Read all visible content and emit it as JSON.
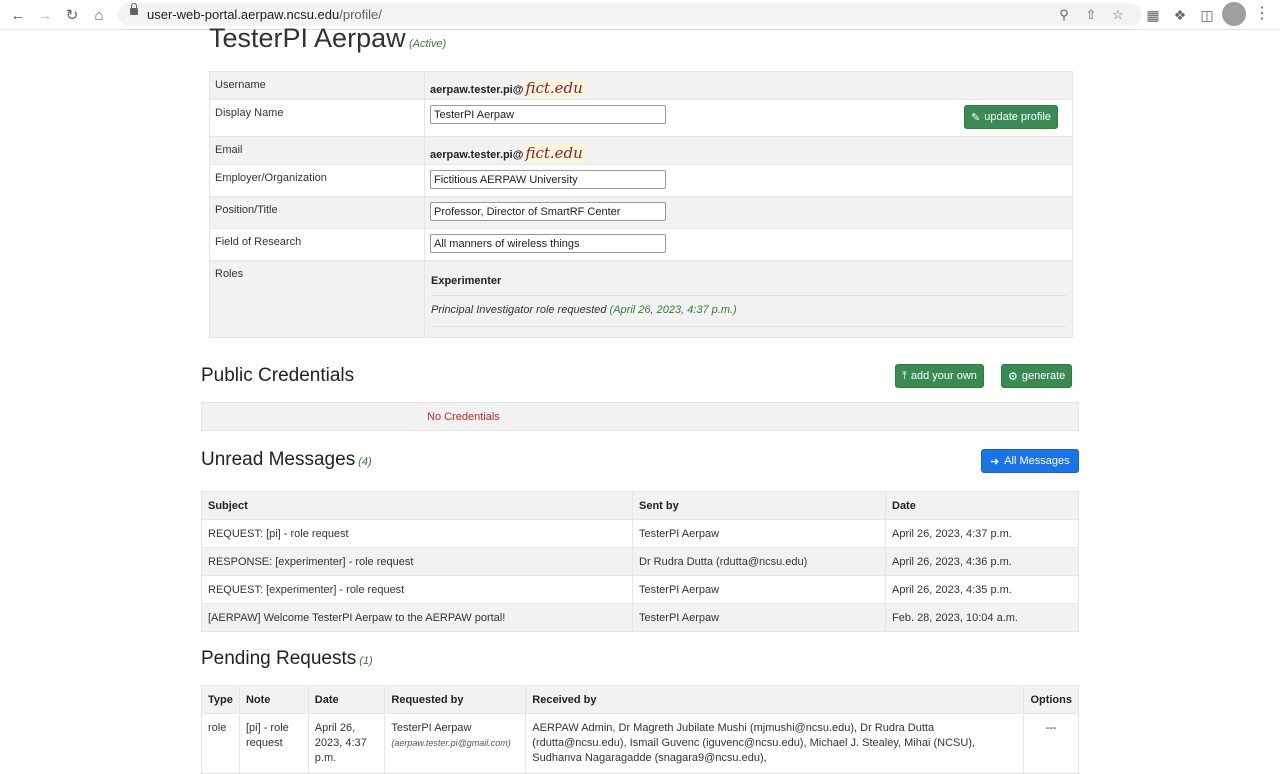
{
  "browser": {
    "url_host": "user-web-portal.aerpaw.ncsu.edu",
    "url_path": "/profile/"
  },
  "profile": {
    "name": "TesterPI Aerpaw",
    "status": "(Active)",
    "fields": {
      "username_label": "Username",
      "username_prefix": "aerpaw.tester.pi@",
      "username_domain": "fict.edu",
      "display_name_label": "Display Name",
      "display_name_value": "TesterPI Aerpaw",
      "email_label": "Email",
      "email_prefix": "aerpaw.tester.pi@",
      "email_domain": "fict.edu",
      "employer_label": "Employer/Organization",
      "employer_value": "Fictitious AERPAW University",
      "position_label": "Position/Title",
      "position_value": "Professor, Director of SmartRF Center",
      "field_label": "Field of Research",
      "field_value": "All manners of wireless things",
      "roles_label": "Roles"
    },
    "roles": {
      "current": "Experimenter",
      "request_text": "Principal Investigator role requested",
      "request_time": "(April 26, 2023, 4:37 p.m.)"
    },
    "update_button": "update profile"
  },
  "credentials": {
    "heading": "Public Credentials",
    "add_button": "add your own",
    "generate_button": "generate",
    "empty_text": "No Credentials"
  },
  "messages": {
    "heading": "Unread Messages",
    "count": "(4)",
    "all_button": "All Messages",
    "columns": [
      "Subject",
      "Sent by",
      "Date"
    ],
    "rows": [
      {
        "subject": "REQUEST: [pi] - role request",
        "sent_by": "TesterPI Aerpaw",
        "date": "April 26, 2023, 4:37 p.m."
      },
      {
        "subject": "RESPONSE: [experimenter] - role request",
        "sent_by": "Dr Rudra Dutta (rdutta@ncsu.edu)",
        "date": "April 26, 2023, 4:36 p.m."
      },
      {
        "subject": "REQUEST: [experimenter] - role request",
        "sent_by": "TesterPI Aerpaw",
        "date": "April 26, 2023, 4:35 p.m."
      },
      {
        "subject": "[AERPAW] Welcome TesterPI Aerpaw to the AERPAW portal!",
        "sent_by": "TesterPI Aerpaw",
        "date": "Feb. 28, 2023, 10:04 a.m."
      }
    ]
  },
  "pending": {
    "heading": "Pending Requests",
    "count": "(1)",
    "columns": [
      "Type",
      "Note",
      "Date",
      "Requested by",
      "Received by",
      "Options"
    ],
    "rows": [
      {
        "type": "role",
        "note": "[pi] - role request",
        "date": "April 26, 2023, 4:37 p.m.",
        "requested_by": "TesterPI Aerpaw",
        "requested_email": "(aerpaw.tester.pi@gmail.com)",
        "received_by": "AERPAW Admin, Dr Magreth Jubilate Mushi (mjmushi@ncsu.edu), Dr Rudra Dutta (rdutta@ncsu.edu), Ismail Guvenc (iguvenc@ncsu.edu), Michael J. Stealey, Mihai (NCSU), Sudhanva Nagaragadde (snagara9@ncsu.edu),",
        "options": "---"
      }
    ]
  }
}
